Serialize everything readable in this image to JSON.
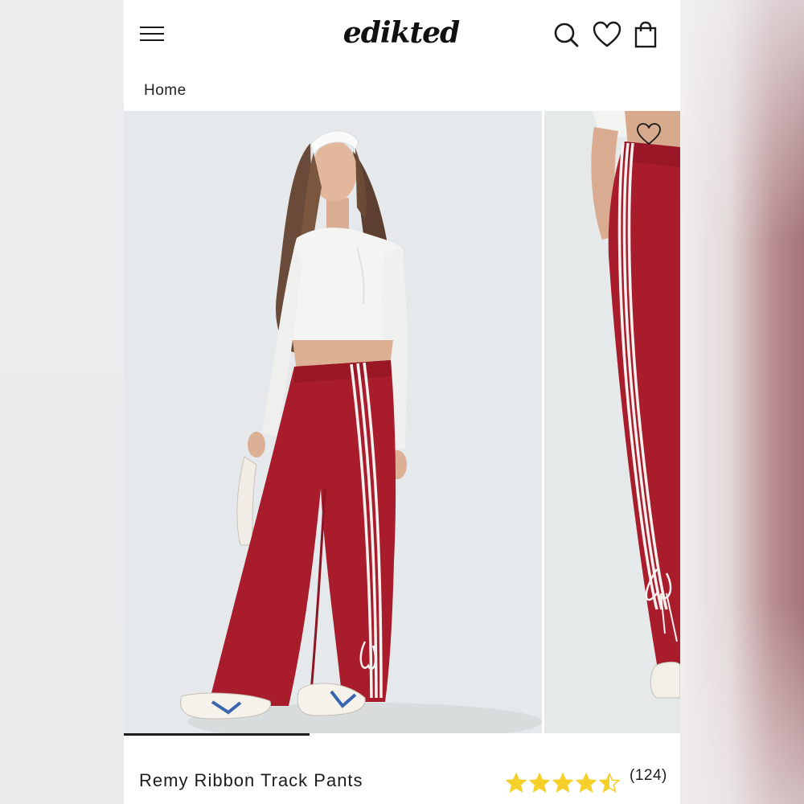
{
  "header": {
    "logo_text": "edikted",
    "icons": [
      "menu-icon",
      "search-icon",
      "heart-icon",
      "bag-icon"
    ]
  },
  "breadcrumb": {
    "home_label": "Home"
  },
  "gallery": {
    "images": [
      "model-front-photo",
      "model-side-photo"
    ],
    "current_index": 1,
    "total": 3
  },
  "product": {
    "title": "Remy Ribbon Track Pants",
    "rating": 4.5,
    "review_count": "(124)"
  },
  "colors": {
    "pants_red": "#a81c2c",
    "star_yellow": "#f5cf2a",
    "text": "#1c1c1c"
  }
}
